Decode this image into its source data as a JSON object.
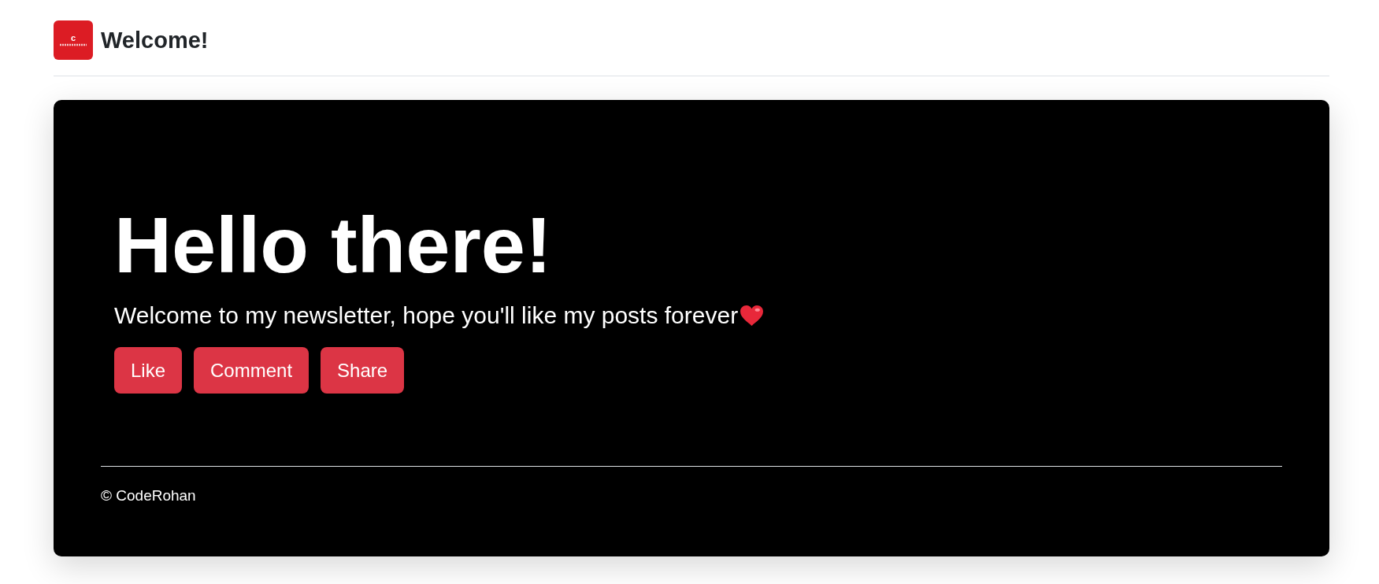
{
  "header": {
    "logo": {
      "letter": "c"
    },
    "title": "Welcome!"
  },
  "hero": {
    "heading": "Hello there!",
    "lead": "Welcome to my newsletter, hope you'll like my posts forever",
    "buttons": [
      "Like",
      "Comment",
      "Share"
    ]
  },
  "footer": {
    "copyright": "© CodeRohan"
  }
}
